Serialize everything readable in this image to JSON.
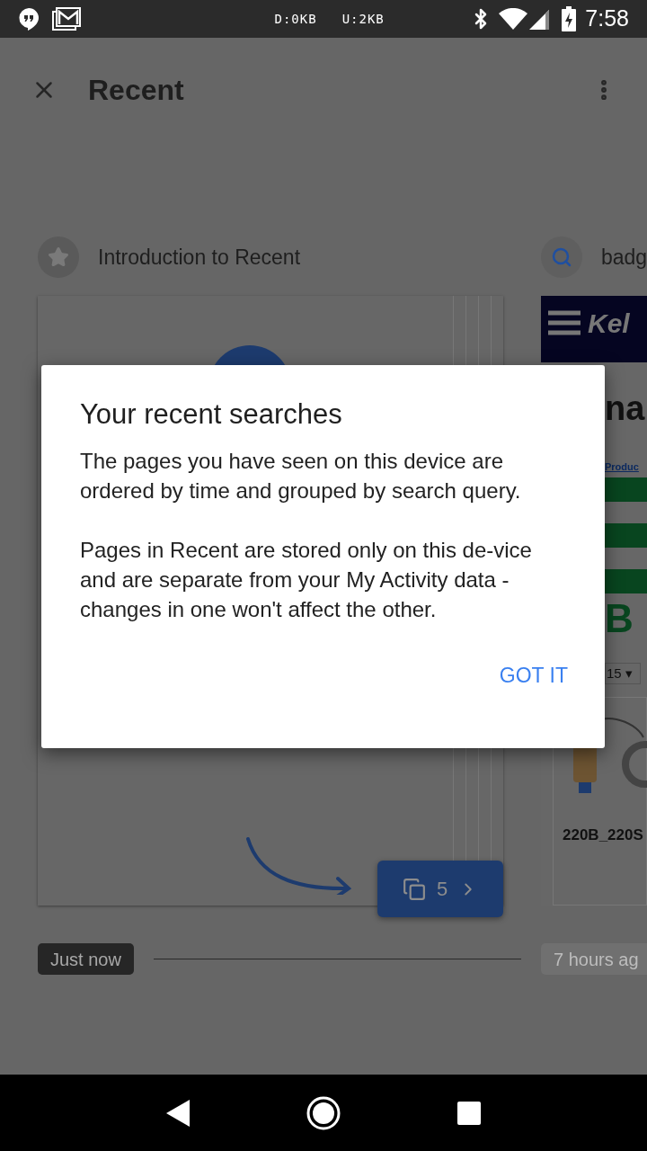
{
  "status_bar": {
    "download": "D:0KB",
    "upload": "U:2KB",
    "time": "7:58"
  },
  "app_bar": {
    "title": "Recent"
  },
  "groups": [
    {
      "kind": "intro",
      "title": "Introduction to Recent",
      "count": "5",
      "time": "Just now",
      "selected": true
    },
    {
      "kind": "search",
      "title": "badg",
      "time": "7 hours ag",
      "selected": false,
      "preview": {
        "logo": "Kel",
        "heading": "na",
        "link": "Produc",
        "brand": "B",
        "select": "15 ▾",
        "caption": "220B_220S"
      }
    }
  ],
  "dialog": {
    "title": "Your recent searches",
    "paragraphs": [
      "The pages you have seen on this device are ordered by time and grouped by search query.",
      "Pages in Recent are stored only on this de-vice and are separate from your My Activity data - changes in one won't affect the other."
    ],
    "button": "GOT IT"
  }
}
